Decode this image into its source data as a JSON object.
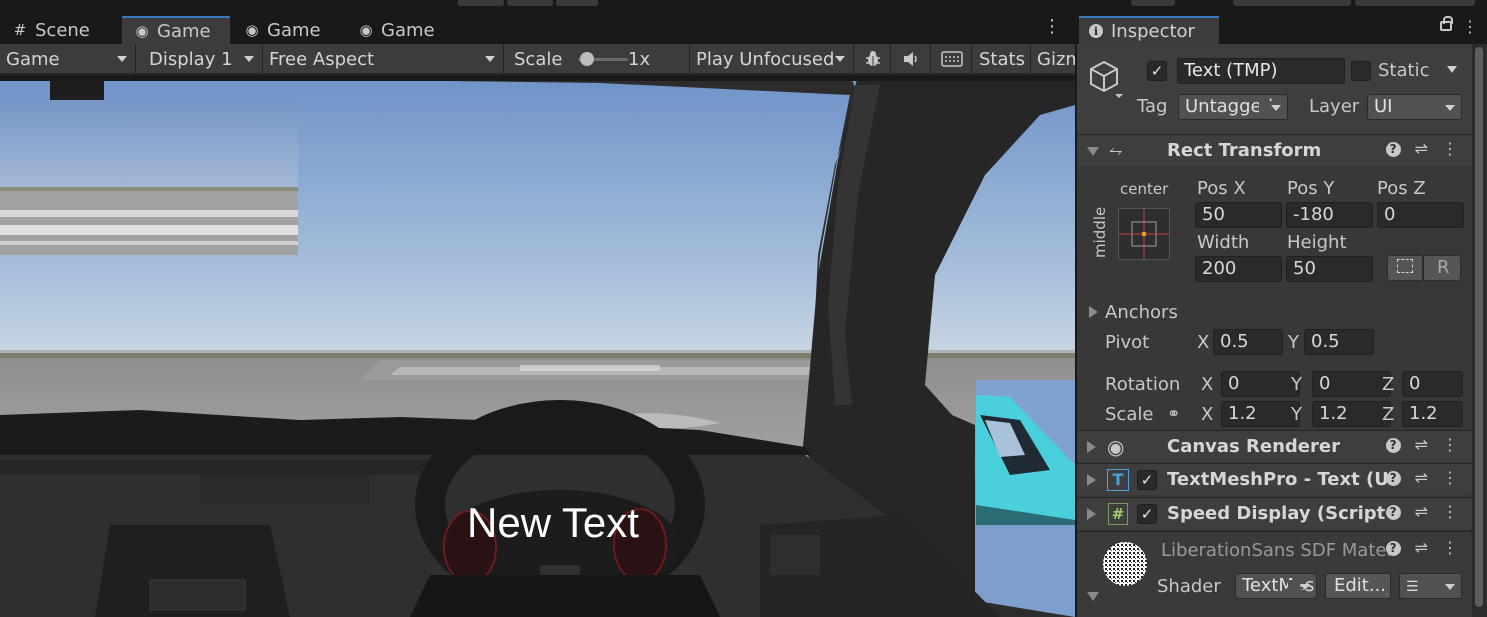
{
  "game_view": {
    "tabs": [
      {
        "icon": "hash-icon",
        "label": "Scene"
      },
      {
        "icon": "gamepad-icon",
        "label": "Game"
      },
      {
        "icon": "gamepad-icon",
        "label": "Game"
      },
      {
        "icon": "gamepad-icon",
        "label": "Game"
      }
    ],
    "toolbar": {
      "game_dropdown": "Game",
      "display_dropdown": "Display 1",
      "aspect_dropdown": "Free Aspect",
      "scale_label": "Scale",
      "scale_value": "1x",
      "play_mode_dropdown": "Play Unfocused",
      "stats_label": "Stats",
      "gizmos_label": "Gizmos"
    },
    "viewport": {
      "ui_text": "New Text"
    }
  },
  "inspector": {
    "tab_label": "Inspector",
    "object": {
      "active": true,
      "name": "Text (TMP)",
      "static_label": "Static",
      "static": false,
      "tag_label": "Tag",
      "tag_value": "Untagged",
      "layer_label": "Layer",
      "layer_value": "UI"
    },
    "rect_transform": {
      "title": "Rect Transform",
      "anchor_h": "center",
      "anchor_v": "middle",
      "pos_x_label": "Pos X",
      "pos_y_label": "Pos Y",
      "pos_z_label": "Pos Z",
      "pos_x": "50",
      "pos_y": "-180",
      "pos_z": "0",
      "width_label": "Width",
      "height_label": "Height",
      "width": "200",
      "height": "50",
      "raw_edit_label": "R",
      "anchors_label": "Anchors",
      "pivot_label": "Pivot",
      "pivot_x": "0.5",
      "pivot_y": "0.5",
      "rotation_label": "Rotation",
      "rotation_x": "0",
      "rotation_y": "0",
      "rotation_z": "0",
      "scale_label": "Scale",
      "scale_x": "1.2",
      "scale_y": "1.2",
      "scale_z": "1.2",
      "x_label": "X",
      "y_label": "Y",
      "z_label": "Z"
    },
    "components": [
      {
        "title": "Canvas Renderer",
        "icon": "eye-icon"
      },
      {
        "title": "TextMeshPro - Text (UI)",
        "icon": "tmp-text-icon",
        "enabled": true
      },
      {
        "title": "Speed Display (Script)",
        "icon": "script-hash-icon",
        "enabled": true
      }
    ],
    "material": {
      "name": "LiberationSans SDF Material",
      "shader_label": "Shader",
      "shader_value": "TextMeshPro/Mobile/Distance Field",
      "edit_label": "Edit..."
    }
  }
}
